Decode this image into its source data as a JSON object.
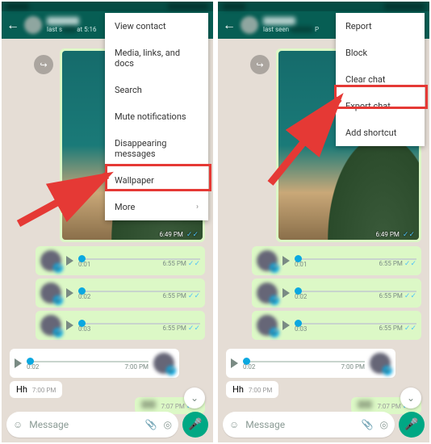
{
  "left": {
    "header": {
      "subtitle_prefix": "last s",
      "subtitle_suffix": "at 5:16"
    },
    "menu": [
      {
        "label": "View contact"
      },
      {
        "label": "Media, links, and docs"
      },
      {
        "label": "Search"
      },
      {
        "label": "Mute notifications"
      },
      {
        "label": "Disappearing messages"
      },
      {
        "label": "Wallpaper"
      },
      {
        "label": "More",
        "chevron": "›"
      }
    ],
    "image_time": "6:49 PM",
    "voice_notes_out": [
      {
        "duration": "0:01",
        "time": "6:55 PM"
      },
      {
        "duration": "0:02",
        "time": "6:55 PM"
      },
      {
        "duration": "0:03",
        "time": "6:55 PM"
      }
    ],
    "voice_note_in": {
      "duration": "0:02",
      "time": "7:00 PM"
    },
    "text_in": {
      "text": "Hh",
      "time": "7:00 PM"
    },
    "text_out": {
      "time": "7:07 PM"
    },
    "input_placeholder": "Message"
  },
  "right": {
    "header": {
      "subtitle_prefix": "last seen",
      "subtitle_suffix": "P"
    },
    "menu": [
      {
        "label": "Report"
      },
      {
        "label": "Block"
      },
      {
        "label": "Clear chat"
      },
      {
        "label": "Export chat"
      },
      {
        "label": "Add shortcut"
      }
    ],
    "image_time": "6:49 PM",
    "voice_notes_out": [
      {
        "duration": "0:01",
        "time": "6:55 PM"
      },
      {
        "duration": "0:02",
        "time": "6:55 PM"
      },
      {
        "duration": "0:03",
        "time": "6:55 PM"
      }
    ],
    "voice_note_in": {
      "duration": "0:02",
      "time": "7:00 PM"
    },
    "text_in": {
      "text": "Hh",
      "time": "7:00 PM"
    },
    "text_out": {
      "time": "7:07 PM"
    },
    "input_placeholder": "Message"
  },
  "icons": {
    "forward": "↪",
    "emoji": "☺",
    "attach": "📎",
    "camera": "◎",
    "mic": "🎤",
    "chevron_down": "⌄",
    "back": "←"
  }
}
